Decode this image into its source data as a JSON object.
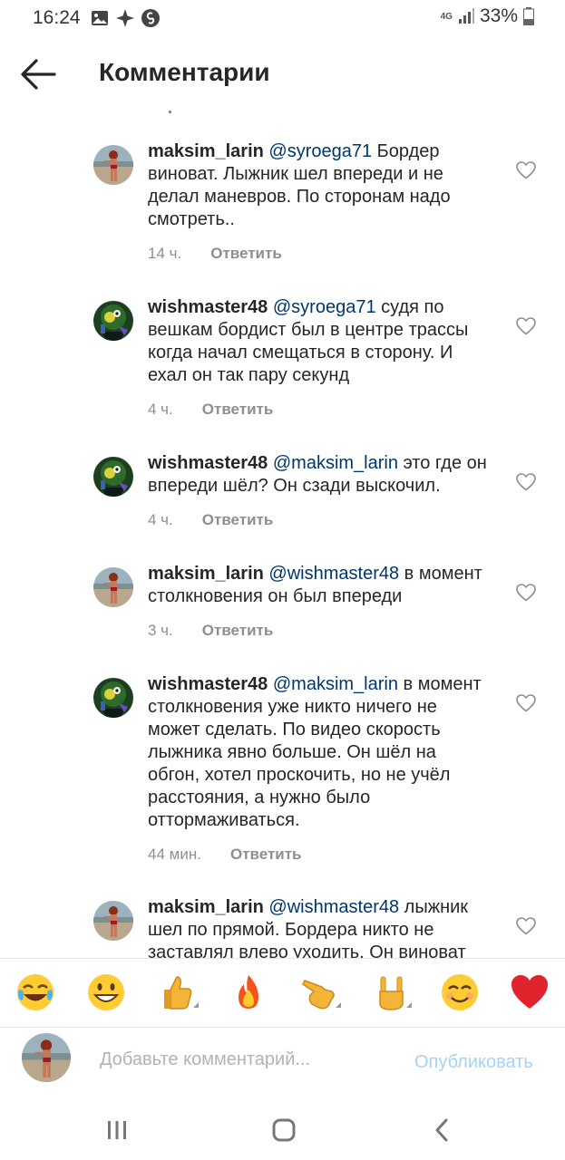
{
  "status_bar": {
    "time": "16:24",
    "network": "4G",
    "battery": "33%"
  },
  "header": {
    "title": "Комментарии"
  },
  "comments": [
    {
      "username": "maksim_larin",
      "mention": "@syroega71",
      "text": " Бордер виноват. Лыжник шел впереди и не делал маневров. По сторонам надо смотреть..",
      "time": "14 ч.",
      "reply": "Ответить",
      "avatar": "beach-avatar"
    },
    {
      "username": "wishmaster48",
      "mention": "@syroega71",
      "text": " судя по вешкам бордист был в центре трассы когда начал смещаться в сторону. И ехал он так пару секунд",
      "time": "4 ч.",
      "reply": "Ответить",
      "avatar": "cartoon-avatar"
    },
    {
      "username": "wishmaster48",
      "mention": "@maksim_larin",
      "text": " это где он впереди шёл? Он сзади выскочил.",
      "time": "4 ч.",
      "reply": "Ответить",
      "avatar": "cartoon-avatar"
    },
    {
      "username": "maksim_larin",
      "mention": "@wishmaster48",
      "text": " в момент столкновения он был впереди",
      "time": "3 ч.",
      "reply": "Ответить",
      "avatar": "beach-avatar"
    },
    {
      "username": "wishmaster48",
      "mention": "@maksim_larin",
      "text": " в момент столкновения уже никто ничего не может сделать. По видео скорость лыжника явно больше. Он шёл на обгон, хотел проскочить, но не учёл расстояния, а нужно было оттормаживаться.",
      "time": "44 мин.",
      "reply": "Ответить",
      "avatar": "cartoon-avatar"
    },
    {
      "username": "maksim_larin",
      "mention": "@wishmaster48",
      "text": " лыжник шел по прямой. Бордера никто не заставлял влево уходить. Он виноват",
      "time": "",
      "reply": "",
      "avatar": "beach-avatar"
    }
  ],
  "emoji_bar": [
    "face-with-tears-of-joy",
    "grinning-face",
    "thumbs-up",
    "fire",
    "backhand-index-pointing",
    "sign-of-the-horns",
    "smiling-face",
    "red-heart"
  ],
  "composer": {
    "placeholder": "Добавьте комментарий...",
    "post_label": "Опубликовать"
  },
  "colors": {
    "mention": "#00376b",
    "muted": "#8e8e8e",
    "post_disabled": "#a6d2f5",
    "heart_emoji": "#e0242e"
  }
}
